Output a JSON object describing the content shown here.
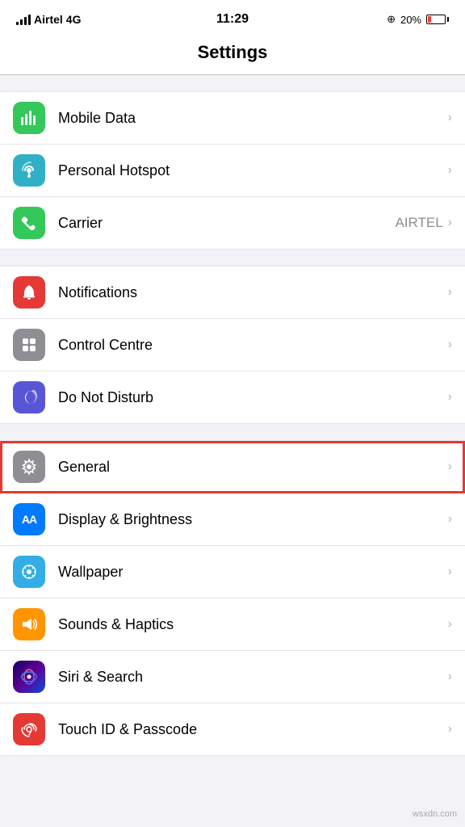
{
  "statusBar": {
    "carrier": "Airtel",
    "network": "4G",
    "time": "11:29",
    "battery": "20%",
    "batteryLevel": 20
  },
  "pageTitle": "Settings",
  "groups": [
    {
      "id": "network",
      "items": [
        {
          "id": "mobile-data",
          "label": "Mobile Data",
          "icon": "📶",
          "iconBg": "icon-green",
          "value": "",
          "chevron": "›"
        },
        {
          "id": "personal-hotspot",
          "label": "Personal Hotspot",
          "icon": "🔗",
          "iconBg": "icon-teal",
          "value": "",
          "chevron": "›"
        },
        {
          "id": "carrier",
          "label": "Carrier",
          "icon": "📞",
          "iconBg": "icon-phone-green",
          "value": "AIRTEL",
          "chevron": "›"
        }
      ]
    },
    {
      "id": "system",
      "items": [
        {
          "id": "notifications",
          "label": "Notifications",
          "icon": "🔔",
          "iconBg": "icon-red",
          "value": "",
          "chevron": "›"
        },
        {
          "id": "control-centre",
          "label": "Control Centre",
          "icon": "⊞",
          "iconBg": "icon-gray",
          "value": "",
          "chevron": "›"
        },
        {
          "id": "do-not-disturb",
          "label": "Do Not Disturb",
          "icon": "🌙",
          "iconBg": "icon-purple",
          "value": "",
          "chevron": "›"
        }
      ]
    },
    {
      "id": "display",
      "items": [
        {
          "id": "general",
          "label": "General",
          "icon": "⚙️",
          "iconBg": "icon-gear",
          "value": "",
          "chevron": "›",
          "highlighted": true
        },
        {
          "id": "display-brightness",
          "label": "Display & Brightness",
          "icon": "AA",
          "iconBg": "icon-blue-aa",
          "value": "",
          "chevron": "›",
          "isText": true
        },
        {
          "id": "wallpaper",
          "label": "Wallpaper",
          "icon": "❋",
          "iconBg": "icon-cyan",
          "value": "",
          "chevron": "›"
        },
        {
          "id": "sounds-haptics",
          "label": "Sounds & Haptics",
          "icon": "🔊",
          "iconBg": "icon-orange",
          "value": "",
          "chevron": "›"
        },
        {
          "id": "siri-search",
          "label": "Siri & Search",
          "icon": "✦",
          "iconBg": "icon-siri",
          "value": "",
          "chevron": "›"
        },
        {
          "id": "touch-id",
          "label": "Touch ID & Passcode",
          "icon": "☁",
          "iconBg": "icon-touch",
          "value": "",
          "chevron": "›"
        }
      ]
    }
  ],
  "watermark": "wsxdn.com"
}
